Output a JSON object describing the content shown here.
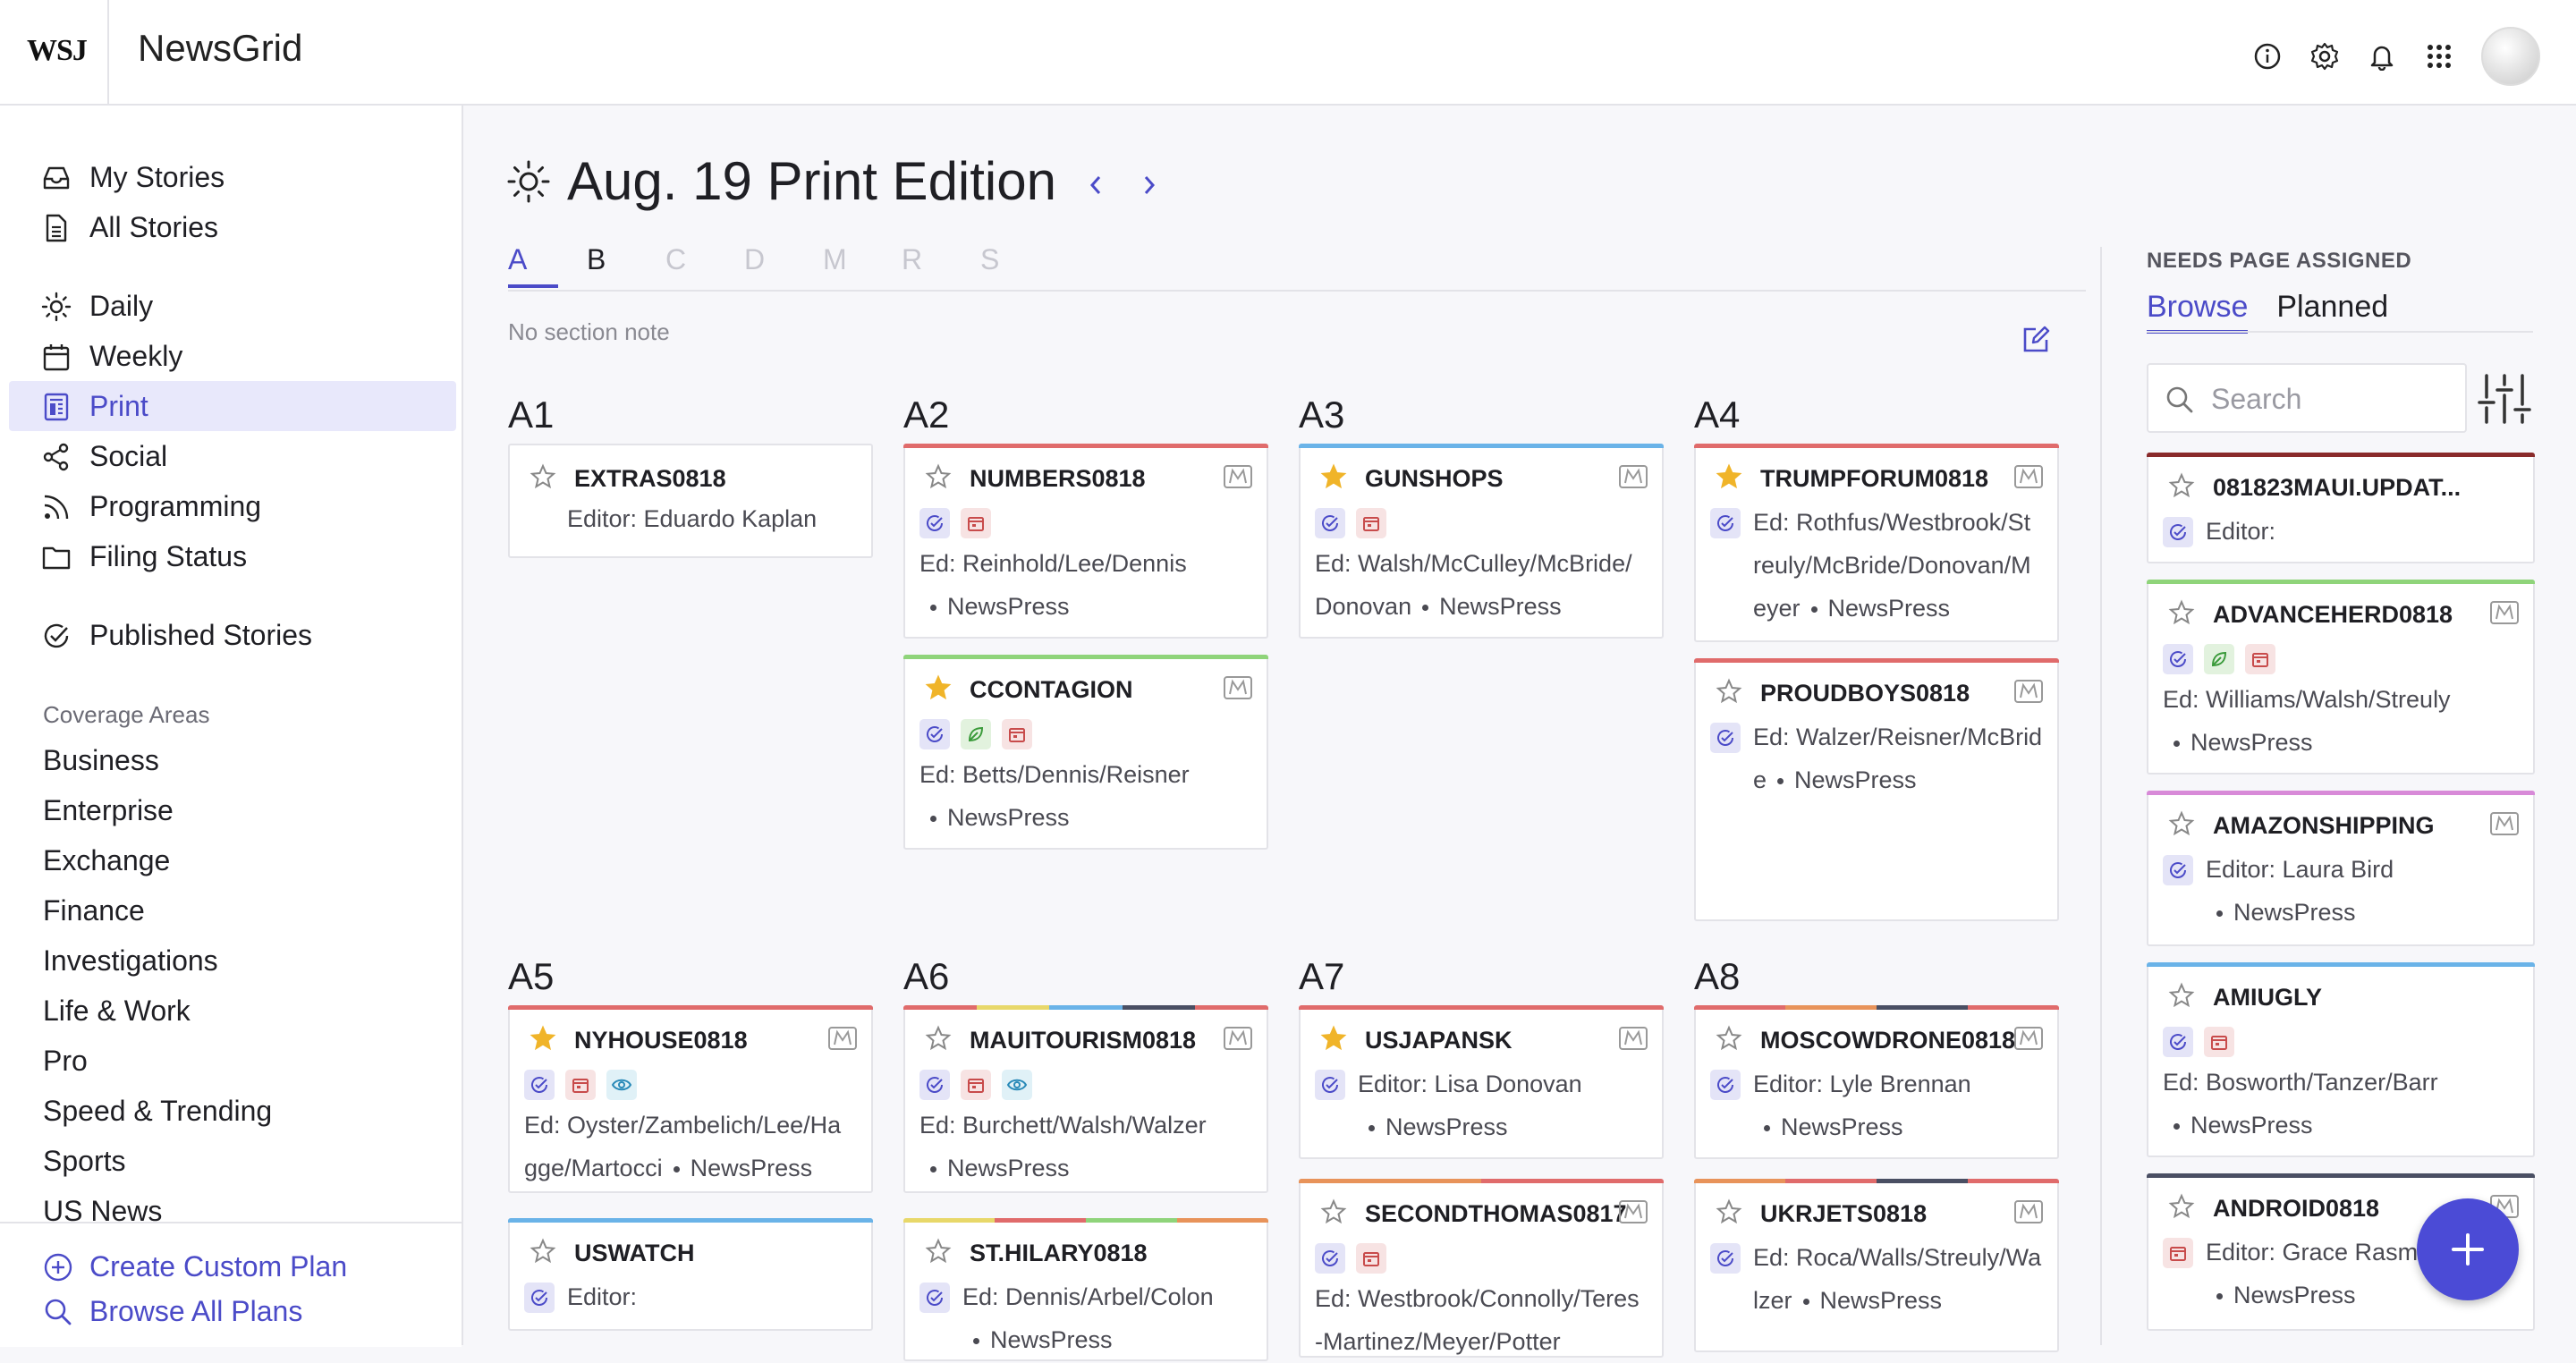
{
  "app": {
    "logo": "WSJ",
    "title": "NewsGrid"
  },
  "topbar": {
    "icons": [
      "info-icon",
      "gear-icon",
      "bell-icon",
      "apps-grid-icon"
    ]
  },
  "sidebar": {
    "items": [
      {
        "label": "My Stories",
        "icon": "inbox-icon"
      },
      {
        "label": "All Stories",
        "icon": "document-icon"
      },
      {
        "label": "Daily",
        "icon": "sun-icon"
      },
      {
        "label": "Weekly",
        "icon": "calendar-icon"
      },
      {
        "label": "Print",
        "icon": "print-layout-icon",
        "active": true
      },
      {
        "label": "Social",
        "icon": "share-icon"
      },
      {
        "label": "Programming",
        "icon": "rss-icon"
      },
      {
        "label": "Filing Status",
        "icon": "folder-icon"
      },
      {
        "label": "Published Stories",
        "icon": "check-circle-icon"
      }
    ],
    "coverage_title": "Coverage Areas",
    "coverage": [
      "Business",
      "Enterprise",
      "Exchange",
      "Finance",
      "Investigations",
      "Life & Work",
      "Pro",
      "Speed & Trending",
      "Sports",
      "US News"
    ],
    "bottom": {
      "create": "Create Custom Plan",
      "browse": "Browse All Plans"
    }
  },
  "main": {
    "edition_title": "Aug. 19 Print Edition",
    "tabs": [
      "A",
      "B",
      "C",
      "D",
      "M",
      "R",
      "S"
    ],
    "active_tab": "A",
    "section_note": "No section note",
    "pages": [
      "A1",
      "A2",
      "A3",
      "A4",
      "A5",
      "A6",
      "A7",
      "A8"
    ],
    "cards": {
      "a1_1": {
        "slug": "EXTRAS0818",
        "body": "Editor: Eduardo Kaplan"
      },
      "a2_1": {
        "slug": "NUMBERS0818",
        "body1": "Ed: Reinhold/Lee/Dennis",
        "body2": "NewsPress"
      },
      "a2_2": {
        "slug": "CCONTAGION",
        "body1": "Ed: Betts/Dennis/Reisner",
        "body2": "NewsPress"
      },
      "a3_1": {
        "slug": "GUNSHOPS",
        "body1": "Ed: Walsh/McCulley/McBride/",
        "body2": "Donovan",
        "body3": "NewsPress"
      },
      "a4_1": {
        "slug": "TRUMPFORUM0818",
        "body1": "Ed: Rothfus/Westbrook/St",
        "body2": "reuly/McBride/Donovan/M",
        "body3": "eyer",
        "body4": "NewsPress"
      },
      "a4_2": {
        "slug": "PROUDBOYS0818",
        "body1": "Ed: Walzer/Reisner/McBrid",
        "body2": "e",
        "body3": "NewsPress"
      },
      "a5_1": {
        "slug": "NYHOUSE0818",
        "body1": "Ed: Oyster/Zambelich/Lee/Ha",
        "body2": "gge/Martocci",
        "body3": "NewsPress"
      },
      "a5_2": {
        "slug": "USWATCH",
        "body1": "Editor:"
      },
      "a6_1": {
        "slug": "MAUITOURISM0818",
        "body1": "Ed: Burchett/Walsh/Walzer",
        "body2": "NewsPress"
      },
      "a6_2": {
        "slug": "ST.HILARY0818",
        "body1": "Ed: Dennis/Arbel/Colon",
        "body2": "NewsPress"
      },
      "a7_1": {
        "slug": "USJAPANSK",
        "body1": "Editor: Lisa Donovan",
        "body2": "NewsPress"
      },
      "a7_2": {
        "slug": "SECONDTHOMAS0817",
        "body1": "Ed: Westbrook/Connolly/Teres",
        "body2": "-Martinez/Meyer/Potter"
      },
      "a8_1": {
        "slug": "MOSCOWDRONE0818",
        "body1": "Editor: Lyle Brennan",
        "body2": "NewsPress"
      },
      "a8_2": {
        "slug": "UKRJETS0818",
        "body1": "Ed: Roca/Walls/Streuly/Wa",
        "body2": "lzer",
        "body3": "NewsPress"
      }
    }
  },
  "right_panel": {
    "title": "NEEDS PAGE ASSIGNED",
    "tabs": [
      "Browse",
      "Planned"
    ],
    "search_placeholder": "Search",
    "cards": [
      {
        "slug": "081823MAUI.UPDAT...",
        "body1": "Editor:"
      },
      {
        "slug": "ADVANCEHERD0818",
        "body1": "Ed: Williams/Walsh/Streuly",
        "body2": "NewsPress"
      },
      {
        "slug": "AMAZONSHIPPING",
        "body1": "Editor: Laura Bird",
        "body2": "NewsPress"
      },
      {
        "slug": "AMIUGLY",
        "body1": "Ed: Bosworth/Tanzer/Barr",
        "body2": "NewsPress"
      },
      {
        "slug": "ANDROID0818",
        "body1": "Editor: Grace Rasm",
        "body2": "NewsPress"
      }
    ]
  },
  "colors": {
    "accent": "#4b4bc8",
    "star_gold": "#f0b429",
    "bar_red": "#e06b6b",
    "bar_blue": "#6ab3e8",
    "bar_green": "#8fd47a",
    "bar_yellow": "#e8d86a",
    "bar_dark": "#4a4f63",
    "bar_orange": "#e8935a",
    "bar_pink": "#d88ad8",
    "bar_maroon": "#8a2b2b"
  }
}
